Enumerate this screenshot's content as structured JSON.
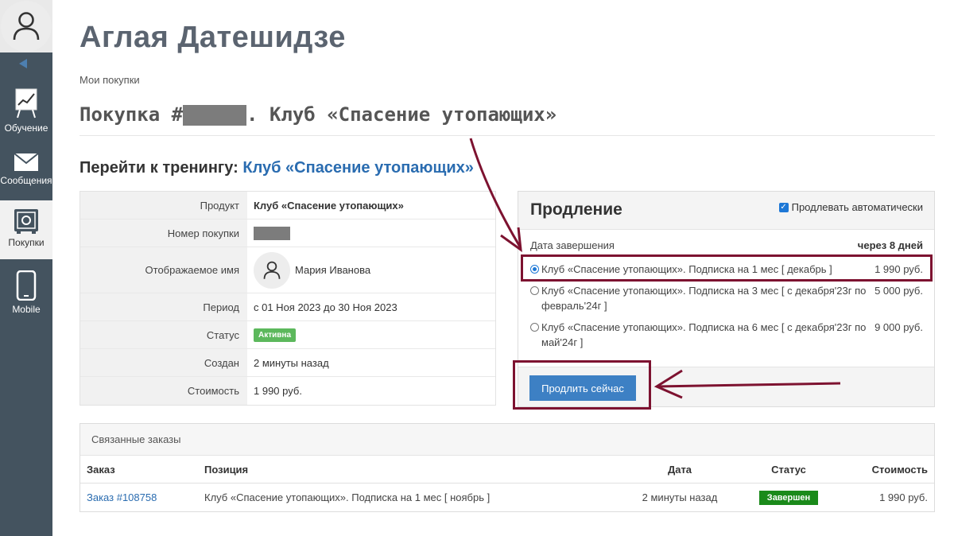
{
  "sidebar": {
    "items": [
      {
        "label": "Обучение",
        "icon": "chart-board-icon"
      },
      {
        "label": "Сообщения",
        "icon": "envelope-icon"
      },
      {
        "label": "Покупки",
        "icon": "safe-icon"
      },
      {
        "label": "Mobile",
        "icon": "smartphone-icon"
      }
    ]
  },
  "header": {
    "user_name": "Аглая Датешидзе",
    "breadcrumb": "Мои покупки",
    "purchase_prefix": "Покупка #",
    "purchase_suffix": ". Клуб «Спасение утопающих»",
    "goto_label": "Перейти к тренингу:",
    "goto_link": "Клуб «Спасение утопающих»"
  },
  "info": {
    "product_label": "Продукт",
    "product_value": "Клуб «Спасение утопающих»",
    "number_label": "Номер покупки",
    "display_name_label": "Отображаемое имя",
    "display_name_value": "Мария Иванова",
    "period_label": "Период",
    "period_value": "с 01 Ноя 2023 до 30 Ноя 2023",
    "status_label": "Статус",
    "status_value": "Активна",
    "created_label": "Создан",
    "created_value": "2 минуты назад",
    "cost_label": "Стоимость",
    "cost_value": "1 990 руб."
  },
  "renewal": {
    "title": "Продление",
    "auto_label": "Продлевать автоматически",
    "auto_checked": true,
    "end_label": "Дата завершения",
    "end_value": "через 8 дней",
    "options": [
      {
        "text": "Клуб «Спасение утопающих». Подписка на 1 мес [ декабрь ]",
        "price": "1 990 руб.",
        "selected": true
      },
      {
        "text": "Клуб «Спасение утопающих». Подписка на 3 мес [ с декабря'23г по февраль'24г ]",
        "price": "5 000 руб.",
        "selected": false
      },
      {
        "text": "Клуб «Спасение утопающих». Подписка на 6 мес [ с декабря'23г по май'24г ]",
        "price": "9 000 руб.",
        "selected": false
      }
    ],
    "button": "Продлить сейчас"
  },
  "orders": {
    "title": "Связанные заказы",
    "columns": [
      "Заказ",
      "Позиция",
      "Дата",
      "Статус",
      "Стоимость"
    ],
    "rows": [
      {
        "order": "Заказ #108758",
        "position": "Клуб «Спасение утопающих». Подписка на 1 мес [ ноябрь ]",
        "date": "2 минуты назад",
        "status": "Завершен",
        "cost": "1 990 руб."
      }
    ]
  },
  "colors": {
    "sidebar": "#44535f",
    "accent": "#3d80c4",
    "link": "#2a6cb0",
    "status_active": "#5cb85c",
    "status_done": "#1a8a1a",
    "annotation": "#7d1230"
  }
}
